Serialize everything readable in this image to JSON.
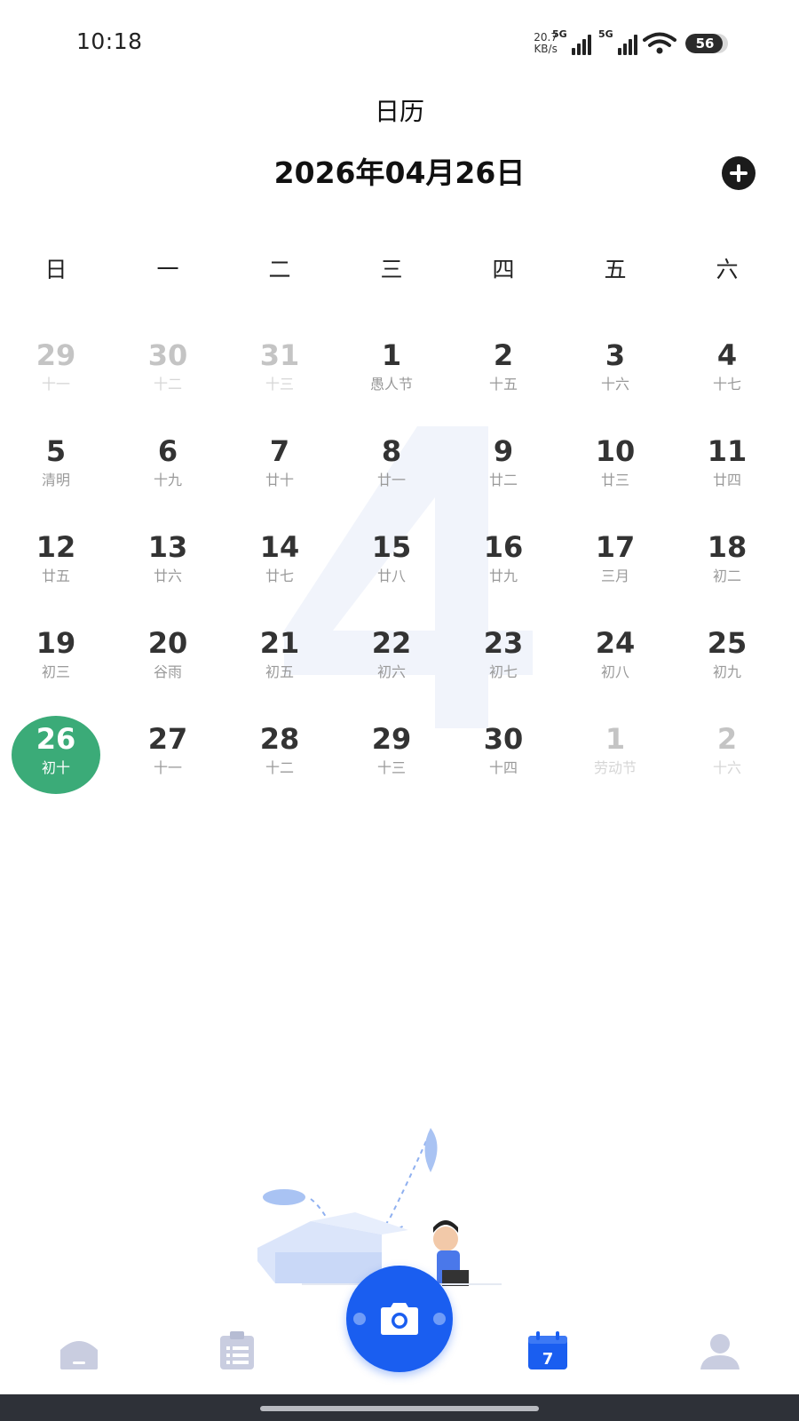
{
  "status_bar": {
    "time": "10:18",
    "net_speed_value": "20.7",
    "net_speed_unit": "KB/s",
    "sim1_network": "5G",
    "sim2_network": "5G",
    "battery_level": "56"
  },
  "header": {
    "title": "日历",
    "date": "2026年04月26日",
    "add_icon": "plus-circle-icon"
  },
  "calendar": {
    "weekdays": [
      "日",
      "一",
      "二",
      "三",
      "四",
      "五",
      "六"
    ],
    "selected_color": "#3bab78",
    "weeks": [
      [
        {
          "day": "29",
          "sub": "十一",
          "muted": true
        },
        {
          "day": "30",
          "sub": "十二",
          "muted": true
        },
        {
          "day": "31",
          "sub": "十三",
          "muted": true
        },
        {
          "day": "1",
          "sub": "愚人节"
        },
        {
          "day": "2",
          "sub": "十五"
        },
        {
          "day": "3",
          "sub": "十六"
        },
        {
          "day": "4",
          "sub": "十七"
        }
      ],
      [
        {
          "day": "5",
          "sub": "清明"
        },
        {
          "day": "6",
          "sub": "十九"
        },
        {
          "day": "7",
          "sub": "廿十"
        },
        {
          "day": "8",
          "sub": "廿一"
        },
        {
          "day": "9",
          "sub": "廿二"
        },
        {
          "day": "10",
          "sub": "廿三"
        },
        {
          "day": "11",
          "sub": "廿四"
        }
      ],
      [
        {
          "day": "12",
          "sub": "廿五"
        },
        {
          "day": "13",
          "sub": "廿六"
        },
        {
          "day": "14",
          "sub": "廿七"
        },
        {
          "day": "15",
          "sub": "廿八"
        },
        {
          "day": "16",
          "sub": "廿九"
        },
        {
          "day": "17",
          "sub": "三月"
        },
        {
          "day": "18",
          "sub": "初二"
        }
      ],
      [
        {
          "day": "19",
          "sub": "初三"
        },
        {
          "day": "20",
          "sub": "谷雨"
        },
        {
          "day": "21",
          "sub": "初五"
        },
        {
          "day": "22",
          "sub": "初六"
        },
        {
          "day": "23",
          "sub": "初七"
        },
        {
          "day": "24",
          "sub": "初八"
        },
        {
          "day": "25",
          "sub": "初九"
        }
      ],
      [
        {
          "day": "26",
          "sub": "初十",
          "selected": true
        },
        {
          "day": "27",
          "sub": "十一"
        },
        {
          "day": "28",
          "sub": "十二"
        },
        {
          "day": "29",
          "sub": "十三"
        },
        {
          "day": "30",
          "sub": "十四"
        },
        {
          "day": "1",
          "sub": "劳动节",
          "muted": true
        },
        {
          "day": "2",
          "sub": "十六",
          "muted": true
        }
      ]
    ]
  },
  "bottom_nav": {
    "items": [
      {
        "icon": "home-icon",
        "active": false
      },
      {
        "icon": "list-icon",
        "active": false
      },
      {
        "icon": "camera-icon",
        "active": false
      },
      {
        "icon": "calendar-icon",
        "badge": "7",
        "active": true
      },
      {
        "icon": "profile-icon",
        "active": false
      }
    ],
    "accent_color": "#1a5ef0",
    "inactive_color": "#c9cde0"
  }
}
